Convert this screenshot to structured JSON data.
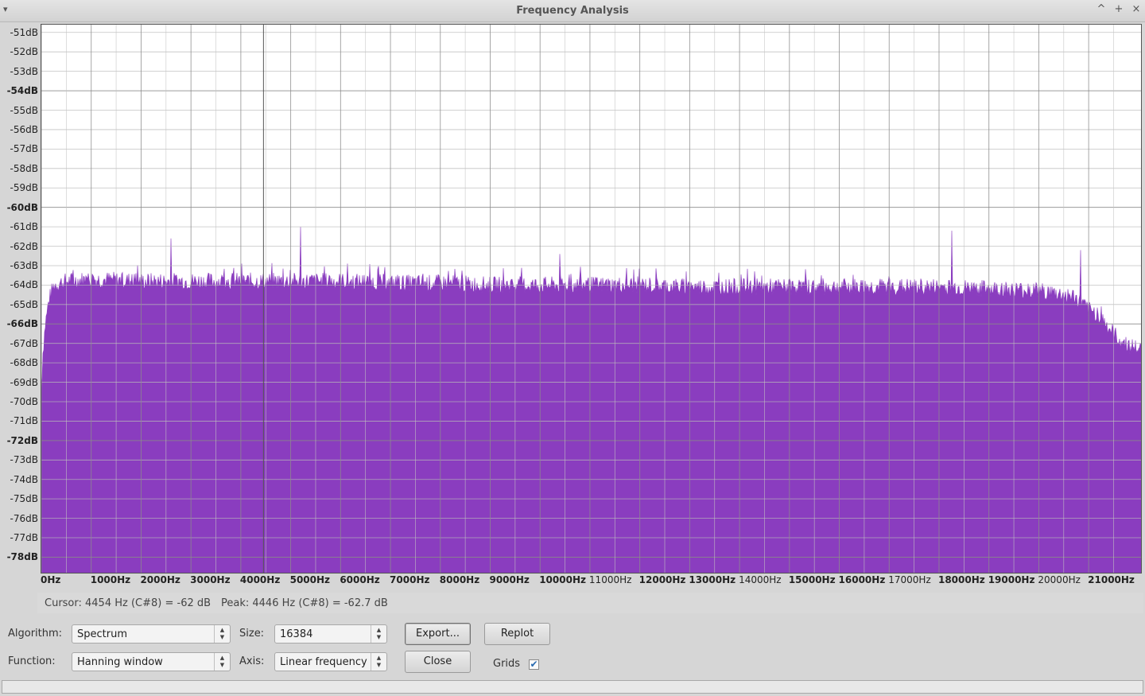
{
  "window": {
    "title": "Frequency Analysis",
    "menu_icon": "chevron-down-icon",
    "controls": [
      "^",
      "+",
      "×"
    ]
  },
  "chart_data": {
    "type": "area",
    "title": "",
    "xlabel": "",
    "ylabel": "",
    "fill_color": "#8a3dbf",
    "grid": true,
    "xlim": [
      0,
      22050
    ],
    "ylim": [
      -78.8,
      -50.6
    ],
    "y_ticks": [
      "-51dB",
      "-52dB",
      "-53dB",
      "-54dB",
      "-55dB",
      "-56dB",
      "-57dB",
      "-58dB",
      "-59dB",
      "-60dB",
      "-61dB",
      "-62dB",
      "-63dB",
      "-64dB",
      "-65dB",
      "-66dB",
      "-67dB",
      "-68dB",
      "-69dB",
      "-70dB",
      "-71dB",
      "-72dB",
      "-73dB",
      "-74dB",
      "-75dB",
      "-76dB",
      "-77dB",
      "-78dB"
    ],
    "y_tick_values": [
      -51,
      -52,
      -53,
      -54,
      -55,
      -56,
      -57,
      -58,
      -59,
      -60,
      -61,
      -62,
      -63,
      -64,
      -65,
      -66,
      -67,
      -68,
      -69,
      -70,
      -71,
      -72,
      -73,
      -74,
      -75,
      -76,
      -77,
      -78
    ],
    "y_bold_ticks": [
      -54,
      -60,
      -66,
      -72,
      -78
    ],
    "x_ticks": [
      "0Hz",
      "1000Hz",
      "2000Hz",
      "3000Hz",
      "4000Hz",
      "5000Hz",
      "6000Hz",
      "7000Hz",
      "8000Hz",
      "9000Hz",
      "10000Hz",
      "11000Hz",
      "12000Hz",
      "13000Hz",
      "14000Hz",
      "15000Hz",
      "16000Hz",
      "17000Hz",
      "18000Hz",
      "19000Hz",
      "20000Hz",
      "21000Hz"
    ],
    "x_tick_values": [
      0,
      1000,
      2000,
      3000,
      4000,
      5000,
      6000,
      7000,
      8000,
      9000,
      10000,
      11000,
      12000,
      13000,
      14000,
      15000,
      16000,
      17000,
      18000,
      19000,
      20000,
      21000
    ],
    "x_normal_ticks": [
      11000,
      14000,
      17000,
      20000
    ],
    "envelope": {
      "x": [
        0,
        30,
        80,
        150,
        250,
        500,
        1000,
        2000,
        3000,
        4000,
        5000,
        6000,
        7000,
        8000,
        9000,
        10000,
        11000,
        12000,
        13000,
        14000,
        15000,
        16000,
        17000,
        18000,
        19000,
        20000,
        20700,
        21000,
        21200,
        21400,
        21600,
        21800,
        22000,
        22050
      ],
      "y": [
        -69.5,
        -67.5,
        -66.0,
        -64.8,
        -64.0,
        -63.8,
        -63.7,
        -63.8,
        -63.8,
        -63.8,
        -63.8,
        -63.8,
        -63.9,
        -63.9,
        -64.0,
        -64.0,
        -64.0,
        -64.0,
        -64.1,
        -64.1,
        -64.1,
        -64.1,
        -64.1,
        -64.1,
        -64.2,
        -64.3,
        -64.6,
        -65.3,
        -65.5,
        -66.2,
        -66.8,
        -67.1,
        -67.3,
        -67.4
      ]
    },
    "peaks": [
      {
        "hz": 2600,
        "db": -61.6
      },
      {
        "hz": 5200,
        "db": -61.0
      },
      {
        "hz": 10400,
        "db": -62.4
      },
      {
        "hz": 18250,
        "db": -61.2
      },
      {
        "hz": 20840,
        "db": -62.2
      }
    ]
  },
  "status": {
    "cursor": "Cursor: 4454 Hz (C#8) = -62 dB",
    "peak": "Peak: 4446 Hz (C#8) = -62.7 dB"
  },
  "controls": {
    "algorithm_label": "Algorithm:",
    "algorithm_value": "Spectrum",
    "size_label": "Size:",
    "size_value": "16384",
    "function_label": "Function:",
    "function_value": "Hanning window",
    "axis_label": "Axis:",
    "axis_value": "Linear frequency",
    "export_label": "Export...",
    "replot_label": "Replot",
    "close_label": "Close",
    "grids_label": "Grids",
    "grids_checked": "✔"
  }
}
